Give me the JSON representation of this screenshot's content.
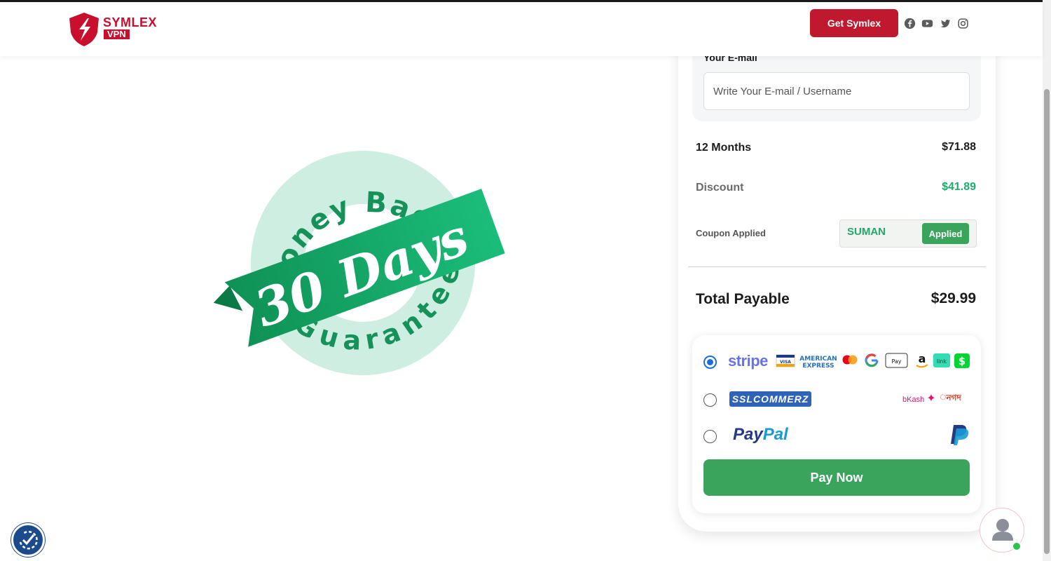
{
  "header": {
    "logo_line1": "SYMLEX",
    "logo_line2": "VPN",
    "cta_label": "Get Symlex",
    "social_icons": [
      "facebook-icon",
      "youtube-icon",
      "twitter-icon",
      "instagram-icon"
    ]
  },
  "badge": {
    "top_arc_text": "Money Back",
    "ribbon_text": "30 Days",
    "bottom_arc_text": "Guarantee",
    "colors": {
      "ring": "#cdeee0",
      "ribbon": "#17a566",
      "text": "#14925a"
    }
  },
  "checkout": {
    "email_label": "Your E-mail",
    "email_placeholder": "Write Your E-mail / Username",
    "email_value": "",
    "plan_label": "12 Months",
    "plan_price": "$71.88",
    "discount_label": "Discount",
    "discount_value": "$41.89",
    "coupon_label": "Coupon Applied",
    "coupon_code": "SUMAN",
    "coupon_status": "Applied",
    "total_label": "Total Payable",
    "total_value": "$29.99",
    "payment_methods": [
      {
        "name": "stripe",
        "selected": true,
        "badges": [
          "visa-icon",
          "amex-icon",
          "mastercard-icon",
          "google-pay-icon",
          "apple-pay-icon",
          "amazon-icon",
          "link-icon",
          "cash-app-icon"
        ]
      },
      {
        "name": "SSLCOMMERZ",
        "selected": false,
        "badges": [
          "bkash-icon",
          "nagad-icon"
        ]
      },
      {
        "name": "PayPal",
        "selected": false,
        "badges": [
          "paypal-icon"
        ]
      }
    ],
    "stripe_text": "stripe",
    "ssl_text": "SSLCOMMERZ",
    "bkash_text": "bKash",
    "nagad_text": "নগদ",
    "paypal_part1": "Pay",
    "paypal_part2": "Pal",
    "pay_button": "Pay Now"
  },
  "colors": {
    "brand_red": "#c0182f",
    "accent_green": "#3aa35c",
    "discount_green": "#1cae6c"
  }
}
